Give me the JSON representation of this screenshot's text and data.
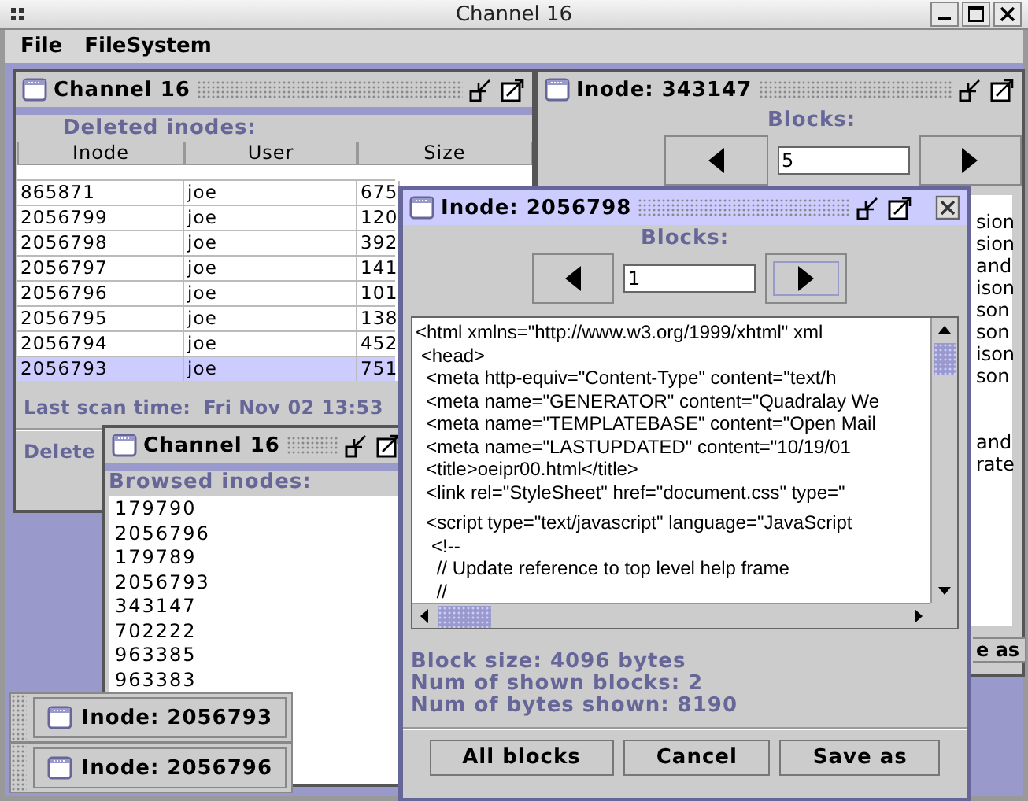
{
  "app": {
    "title": "Channel 16"
  },
  "menu": [
    "File",
    "FileSystem"
  ],
  "deleted_frame": {
    "title": "Channel 16",
    "active": false,
    "heading": "Deleted inodes:",
    "columns": [
      "Inode",
      "User",
      "Size"
    ],
    "rows": [
      {
        "cells": [
          "865871",
          "joe",
          "675"
        ],
        "selected": false
      },
      {
        "cells": [
          "2056799",
          "joe",
          "120"
        ],
        "selected": false
      },
      {
        "cells": [
          "2056798",
          "joe",
          "392"
        ],
        "selected": false
      },
      {
        "cells": [
          "2056797",
          "joe",
          "141"
        ],
        "selected": false
      },
      {
        "cells": [
          "2056796",
          "joe",
          "101"
        ],
        "selected": false
      },
      {
        "cells": [
          "2056795",
          "joe",
          "138"
        ],
        "selected": false
      },
      {
        "cells": [
          "2056794",
          "joe",
          "452"
        ],
        "selected": false
      },
      {
        "cells": [
          "2056793",
          "joe",
          "751"
        ],
        "selected": true
      }
    ],
    "scan_label": "Last scan time:",
    "scan_time": "Fri Nov 02 13:53",
    "delete_button": "Delete"
  },
  "back_frame": {
    "title": "Inode: 343147",
    "active": false,
    "blocks_label": "Blocks:",
    "block_value": "5",
    "fragments": [
      {
        "kind": "text",
        "text": "sion"
      },
      {
        "kind": "text",
        "text": "sion"
      },
      {
        "kind": "text",
        "text": "and"
      },
      {
        "kind": "text",
        "text": "ison"
      },
      {
        "kind": "text",
        "text": "son"
      },
      {
        "kind": "text",
        "text": "son"
      },
      {
        "kind": "text",
        "text": "ison"
      },
      {
        "kind": "text",
        "text": "son"
      },
      {
        "kind": "blank"
      },
      {
        "kind": "blank"
      },
      {
        "kind": "text",
        "text": "and"
      },
      {
        "kind": "text",
        "text": "rate"
      }
    ],
    "button_fragment": "e as"
  },
  "browsed_frame": {
    "title": "Channel 16",
    "active": false,
    "heading": "Browsed inodes:",
    "items": [
      "179790",
      "2056796",
      "179789",
      "2056793",
      "343147",
      "702222",
      "963385",
      "963383"
    ]
  },
  "iconified_frames": [
    {
      "title": "Inode: 2056793"
    },
    {
      "title": "Inode: 2056796"
    }
  ],
  "front_frame": {
    "title": "Inode: 2056798",
    "active": true,
    "blocks_label": "Blocks:",
    "block_value": "1",
    "lines": [
      {
        "kind": "text",
        "text": "<html xmlns=\"http://www.w3.org/1999/xhtml\" xml"
      },
      {
        "kind": "text",
        "text": " <head>"
      },
      {
        "kind": "text",
        "text": "  <meta http-equiv=\"Content-Type\" content=\"text/h"
      },
      {
        "kind": "text",
        "text": "  <meta name=\"GENERATOR\" content=\"Quadralay We"
      },
      {
        "kind": "text",
        "text": "  <meta name=\"TEMPLATEBASE\" content=\"Open Mail"
      },
      {
        "kind": "text",
        "text": "  <meta name=\"LASTUPDATED\" content=\"10/19/01"
      },
      {
        "kind": "text",
        "text": "  <title>oeipr00.html</title>"
      },
      {
        "kind": "text",
        "text": "  <link rel=\"StyleSheet\" href=\"document.css\" type=\""
      },
      {
        "kind": "blank"
      },
      {
        "kind": "text",
        "text": "  <script type=\"text/javascript\" language=\"JavaScript"
      },
      {
        "kind": "text",
        "text": "   <!--"
      },
      {
        "kind": "text",
        "text": "    // Update reference to top level help frame"
      },
      {
        "kind": "text",
        "text": "    //"
      }
    ],
    "info": [
      "Block size: 4096 bytes",
      "Num of shown blocks: 2",
      "Num of bytes shown: 8190"
    ],
    "buttons": [
      "All blocks",
      "Cancel",
      "Save as"
    ]
  }
}
